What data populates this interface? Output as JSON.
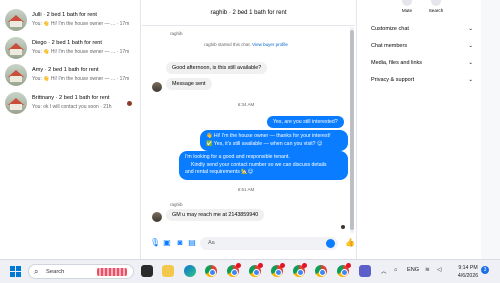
{
  "conversations": [
    {
      "name": "Julli · 2 bed 1 bath for rent",
      "preview": "You: 👋 Hi! I'm the house owner — ...",
      "time": "17m"
    },
    {
      "name": "Diego · 2 bed 1 bath for rent",
      "preview": "You: 👋 Hi! I'm the house owner — ...",
      "time": "17m"
    },
    {
      "name": "Amy · 2 bed 1 bath for rent",
      "preview": "You: 👋 Hi! I'm the house owner — ...",
      "time": "17m"
    },
    {
      "name": "Brittnany · 2 bed 1 bath for rent",
      "preview": "You: ok I will contact you soon · 21h"
    }
  ],
  "chat": {
    "title": "raghib · 2 bed 1 bath for rent",
    "sender_top": "raghib",
    "system_text": "raghib started this chat.",
    "system_link": "View buyer profile",
    "messages_in_1": [
      "Good afternoon, is this still available?",
      "Message sent"
    ],
    "time_1": "6:34 AM",
    "messages_out": [
      "Yes, are you still interested?",
      "👋 Hi! I'm the house owner — thanks for your interest!",
      "✅ Yes, it's still available — when can you visit? 😊",
      "I'm looking for a good and responsible tenant.",
      "Kindly send your contact number so we can discuss details",
      "and rental requirements 🏡😊"
    ],
    "time_2": "6:51 AM",
    "sender_bottom": "raghib",
    "message_in_2": "GM u may reach me at 2143859940",
    "composer_placeholder": "Aa"
  },
  "details": {
    "mute_label": "Mute",
    "search_label": "Search",
    "sections": [
      "Customize chat",
      "Chat members",
      "Media, files and links",
      "Privacy & support"
    ]
  },
  "taskbar": {
    "search_placeholder": "Search",
    "language": "ENG",
    "time": "9:14 PM",
    "date": "4/6/2026",
    "notification_count": "3"
  },
  "colors": {
    "accent": "#0a7cff",
    "bubble_in": "#f0f0f0"
  }
}
